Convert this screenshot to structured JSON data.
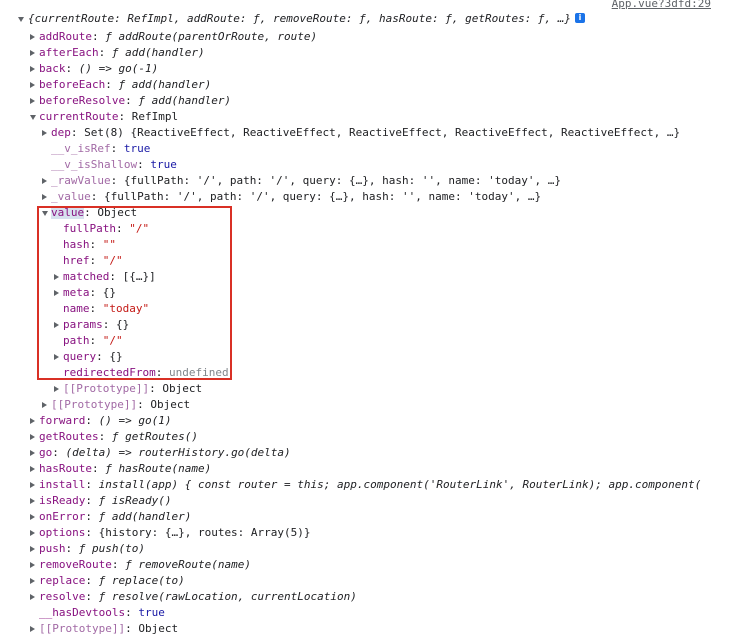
{
  "source_link": "App.vue?3dfd:29",
  "info_icon": "i",
  "root_summary": "{currentRoute: RefImpl, addRoute: ƒ, removeRoute: ƒ, hasRoute: ƒ, getRoutes: ƒ, …}",
  "rows": [
    {
      "key": "addRoute",
      "value": "ƒ addRoute(parentOrRoute, route)"
    },
    {
      "key": "afterEach",
      "value": "ƒ add(handler)"
    },
    {
      "key": "back",
      "value": "() => go(-1)"
    },
    {
      "key": "beforeEach",
      "value": "ƒ add(handler)"
    },
    {
      "key": "beforeResolve",
      "value": "ƒ add(handler)"
    },
    {
      "key": "currentRoute",
      "value": "RefImpl"
    },
    {
      "key": "dep",
      "value": "Set(8) {ReactiveEffect, ReactiveEffect, ReactiveEffect, ReactiveEffect, ReactiveEffect, …}"
    },
    {
      "key": "__v_isRef",
      "value": "true"
    },
    {
      "key": "__v_isShallow",
      "value": "true"
    },
    {
      "key": "_rawValue",
      "value": "{fullPath: '/', path: '/', query: {…}, hash: '', name: 'today', …}"
    },
    {
      "key": "_value",
      "value": "{fullPath: '/', path: '/', query: {…}, hash: '', name: 'today', …}"
    },
    {
      "key": "value",
      "value": "Object"
    },
    {
      "key": "fullPath",
      "value": "\"/\""
    },
    {
      "key": "hash",
      "value": "\"\""
    },
    {
      "key": "href",
      "value": "\"/\""
    },
    {
      "key": "matched",
      "value": "[{…}]"
    },
    {
      "key": "meta",
      "value": "{}"
    },
    {
      "key": "name",
      "value": "\"today\""
    },
    {
      "key": "params",
      "value": "{}"
    },
    {
      "key": "path",
      "value": "\"/\""
    },
    {
      "key": "query",
      "value": "{}"
    },
    {
      "key": "redirectedFrom",
      "value": "undefined"
    },
    {
      "key": "[[Prototype]]",
      "value": "Object"
    },
    {
      "key": "[[Prototype]]",
      "value": "Object"
    },
    {
      "key": "forward",
      "value": "() => go(1)"
    },
    {
      "key": "getRoutes",
      "value": "ƒ getRoutes()"
    },
    {
      "key": "go",
      "value": "(delta) => routerHistory.go(delta)"
    },
    {
      "key": "hasRoute",
      "value": "ƒ hasRoute(name)"
    },
    {
      "key": "install",
      "value": "install(app) { const router = this; app.component('RouterLink', RouterLink); app.component("
    },
    {
      "key": "isReady",
      "value": "ƒ isReady()"
    },
    {
      "key": "onError",
      "value": "ƒ add(handler)"
    },
    {
      "key": "options",
      "value": "{history: {…}, routes: Array(5)}"
    },
    {
      "key": "push",
      "value": "ƒ push(to)"
    },
    {
      "key": "removeRoute",
      "value": "ƒ removeRoute(name)"
    },
    {
      "key": "replace",
      "value": "ƒ replace(to)"
    },
    {
      "key": "resolve",
      "value": "ƒ resolve(rawLocation, currentLocation)"
    },
    {
      "key": "__hasDevtools",
      "value": "true"
    },
    {
      "key": "[[Prototype]]",
      "value": "Object"
    }
  ]
}
